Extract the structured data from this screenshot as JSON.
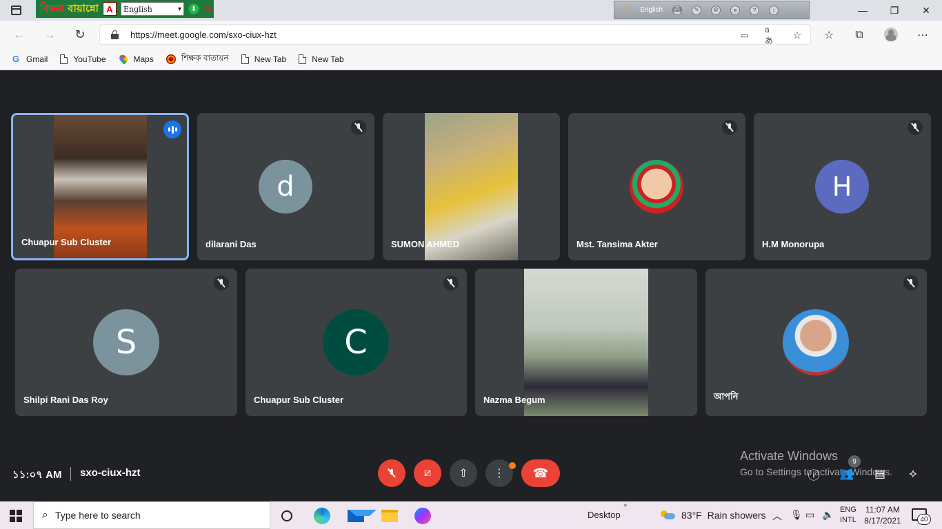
{
  "titlebar": {
    "bijoy_logo_part1": "বিজয়",
    "bijoy_logo_part2": "বায়ান্নো",
    "bijoy_language": "English",
    "ime_language": "English"
  },
  "browser": {
    "url_scheme": "https://",
    "url_host": "meet.google.com",
    "url_path": "/sxo-ciux-hzt"
  },
  "bookmarks": [
    {
      "label": "Gmail",
      "icon": "google-icon"
    },
    {
      "label": "YouTube",
      "icon": "page-icon"
    },
    {
      "label": "Maps",
      "icon": "maps-pin-icon"
    },
    {
      "label": "শিক্ষক বাতায়ন",
      "icon": "shikkhok-batayon-icon"
    },
    {
      "label": "New Tab",
      "icon": "page-icon"
    },
    {
      "label": "New Tab",
      "icon": "page-icon"
    }
  ],
  "participants": [
    {
      "name": "Chuapur Sub Cluster",
      "speaking": true,
      "type": "video"
    },
    {
      "name": "dilarani Das",
      "muted": true,
      "type": "letter",
      "letter": "d",
      "color": "#7b939c"
    },
    {
      "name": "SUMON AHMED",
      "type": "video"
    },
    {
      "name": "Mst. Tansima Akter",
      "muted": true,
      "type": "photo"
    },
    {
      "name": "H.M Monorupa",
      "muted": true,
      "type": "letter",
      "letter": "H",
      "color": "#5c6bc0"
    },
    {
      "name": "Shilpi Rani Das Roy",
      "muted": true,
      "type": "letter",
      "letter": "S",
      "color": "#7b939c"
    },
    {
      "name": "Chuapur Sub Cluster",
      "muted": true,
      "type": "letter",
      "letter": "C",
      "color": "#004d40"
    },
    {
      "name": "Nazma Begum",
      "type": "video"
    },
    {
      "name": "আপনি",
      "muted": true,
      "type": "photo"
    }
  ],
  "meeting": {
    "time": "১১:০৭ AM",
    "code": "sxo-ciux-hzt",
    "people_count": "9"
  },
  "watermark": {
    "line1": "Activate Windows",
    "line2": "Go to Settings to activate Windows."
  },
  "taskbar": {
    "search_placeholder": "Type here to search",
    "desktop_label": "Desktop",
    "weather_temp": "83°F",
    "weather_text": "Rain showers",
    "lang_top": "ENG",
    "lang_bottom": "INTL",
    "time": "11:07 AM",
    "date": "8/17/2021",
    "notification_count": "40"
  }
}
